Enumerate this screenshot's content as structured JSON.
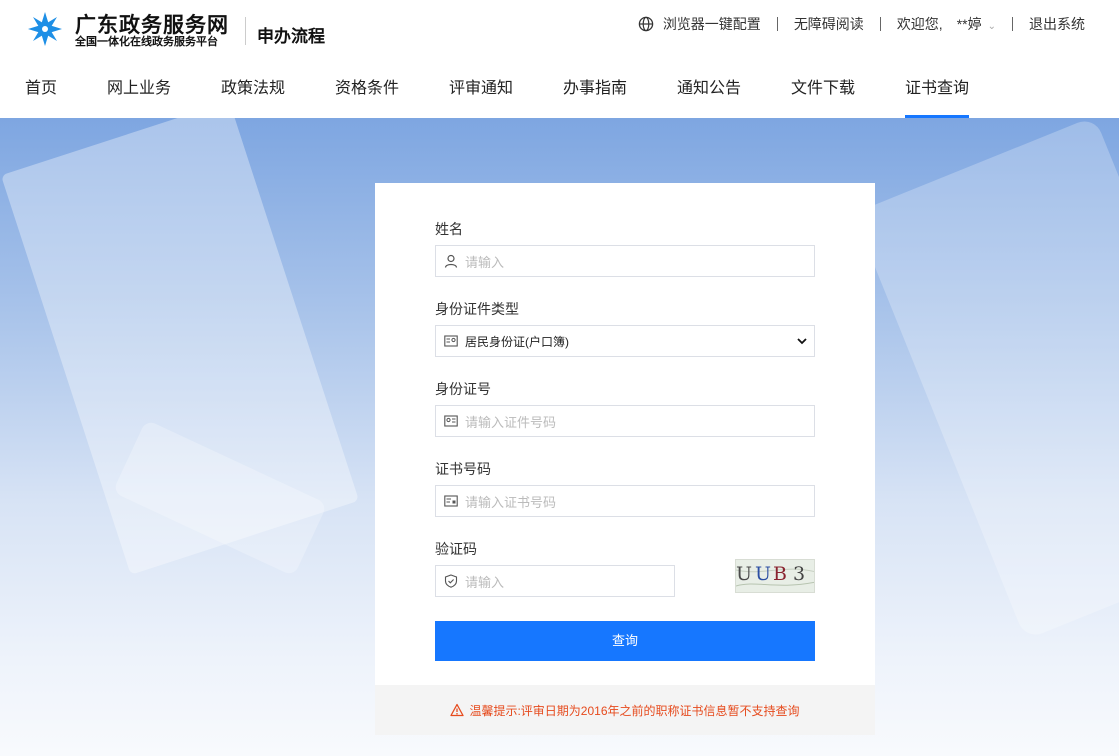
{
  "header": {
    "site_name": "广东政务服务网",
    "site_subtitle": "全国一体化在线政务服务平台",
    "section_title": "申办流程",
    "browser_config": "浏览器一键配置",
    "accessibility": "无障碍阅读",
    "welcome": "欢迎您,",
    "username": "**婷",
    "logout": "退出系统"
  },
  "nav": {
    "items": [
      {
        "label": "首页"
      },
      {
        "label": "网上业务"
      },
      {
        "label": "政策法规"
      },
      {
        "label": "资格条件"
      },
      {
        "label": "评审通知"
      },
      {
        "label": "办事指南"
      },
      {
        "label": "通知公告"
      },
      {
        "label": "文件下载"
      },
      {
        "label": "证书查询"
      }
    ],
    "active": "证书查询"
  },
  "form": {
    "name_label": "姓名",
    "name_placeholder": "请输入",
    "id_type_label": "身份证件类型",
    "id_type_value": "居民身份证(户口簿)",
    "id_number_label": "身份证号",
    "id_number_placeholder": "请输入证件号码",
    "cert_number_label": "证书号码",
    "cert_number_placeholder": "请输入证书号码",
    "captcha_label": "验证码",
    "captcha_placeholder": "请输入",
    "captcha_chars": [
      "U",
      "U",
      "B",
      "3"
    ],
    "submit_label": "查询"
  },
  "notice": {
    "text": "温馨提示:评审日期为2016年之前的职称证书信息暂不支持查询"
  },
  "colors": {
    "primary": "#1677ff",
    "warning": "#e64b1e"
  }
}
